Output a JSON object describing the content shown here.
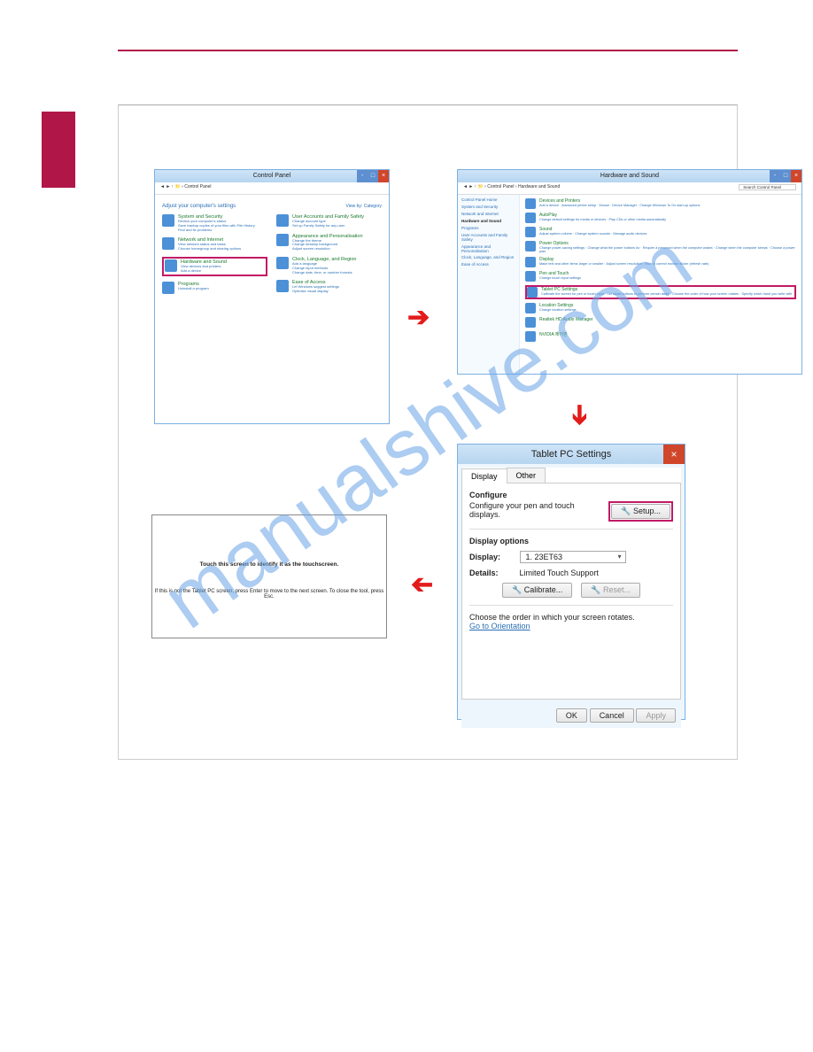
{
  "watermark": "manualshive.com",
  "panel1": {
    "title": "Control Panel",
    "address": "Control Panel",
    "heading": "Adjust your computer's settings",
    "view_by": "View by: Category",
    "items_left": [
      {
        "hl": "System and Security",
        "sub": "Review your computer's status\nSave backup copies of your files with File History\nFind and fix problems"
      },
      {
        "hl": "Network and Internet",
        "sub": "View network status and tasks\nChoose homegroup and sharing options"
      },
      {
        "hl": "Hardware and Sound",
        "sub": "View devices and printers\nAdd a device",
        "highlight": true
      },
      {
        "hl": "Programs",
        "sub": "Uninstall a program"
      }
    ],
    "items_right": [
      {
        "hl": "User Accounts and Family Safety",
        "sub": "Change account type\nSet up Family Safety for any user"
      },
      {
        "hl": "Appearance and Personalisation",
        "sub": "Change the theme\nChange desktop background\nAdjust screen resolution"
      },
      {
        "hl": "Clock, Language, and Region",
        "sub": "Add a language\nChange input methods\nChange date, time, or number formats"
      },
      {
        "hl": "Ease of Access",
        "sub": "Let Windows suggest settings\nOptimise visual display"
      }
    ]
  },
  "panel2": {
    "title": "Hardware and Sound",
    "address": "Control Panel › Hardware and Sound",
    "search_placeholder": "Search Control Panel",
    "side": [
      "Control Panel Home",
      "System and Security",
      "Network and Internet",
      "Hardware and Sound",
      "Programs",
      "User Accounts and Family Safety",
      "Appearance and Personalisation",
      "Clock, Language, and Region",
      "Ease of Access"
    ],
    "side_current_index": 3,
    "items": [
      {
        "hl": "Devices and Printers",
        "sub": "Add a device · Advanced printer setup · Mouse · Device Manager · Change Windows To Go start-up options"
      },
      {
        "hl": "AutoPlay",
        "sub": "Change default settings for media or devices · Play CDs or other media automatically"
      },
      {
        "hl": "Sound",
        "sub": "Adjust system volume · Change system sounds · Manage audio devices"
      },
      {
        "hl": "Power Options",
        "sub": "Change power-saving settings · Change what the power buttons do · Require a password when the computer wakes · Change when the computer sleeps · Choose a power plan"
      },
      {
        "hl": "Display",
        "sub": "Make text and other items larger or smaller · Adjust screen resolution · How to correct monitor flicker (refresh rate)"
      },
      {
        "hl": "Pen and Touch",
        "sub": "Change touch input settings"
      },
      {
        "hl": "Tablet PC Settings",
        "sub": "Calibrate the screen for pen or touch input · Set tablet buttons to perform certain tasks · Choose the order of how your screen rotates · Specify which hand you write with",
        "highlight": true
      },
      {
        "hl": "Location Settings",
        "sub": "Change location settings"
      },
      {
        "hl": "Realtek HD Audio Manager",
        "sub": ""
      },
      {
        "hl": "NVIDIA 제어판",
        "sub": ""
      }
    ]
  },
  "dlg": {
    "title": "Tablet PC Settings",
    "tabs": [
      "Display",
      "Other"
    ],
    "configure": "Configure",
    "configure_desc": "Configure your pen and touch displays.",
    "setup_btn": "Setup...",
    "display_options": "Display options",
    "display_label": "Display:",
    "display_value": "1. 23ET63",
    "details_label": "Details:",
    "details_value": "Limited Touch Support",
    "calibrate_btn": "Calibrate...",
    "reset_btn": "Reset...",
    "rotate_text": "Choose the order in which your screen rotates.",
    "orientation_link": "Go to Orientation",
    "ok": "OK",
    "cancel": "Cancel",
    "apply": "Apply"
  },
  "ident": {
    "main": "Touch this screen to identify it as the touchscreen.",
    "sub": "If this is not the Tablet PC screen, press Enter to move to the next screen. To close the tool, press Esc."
  }
}
